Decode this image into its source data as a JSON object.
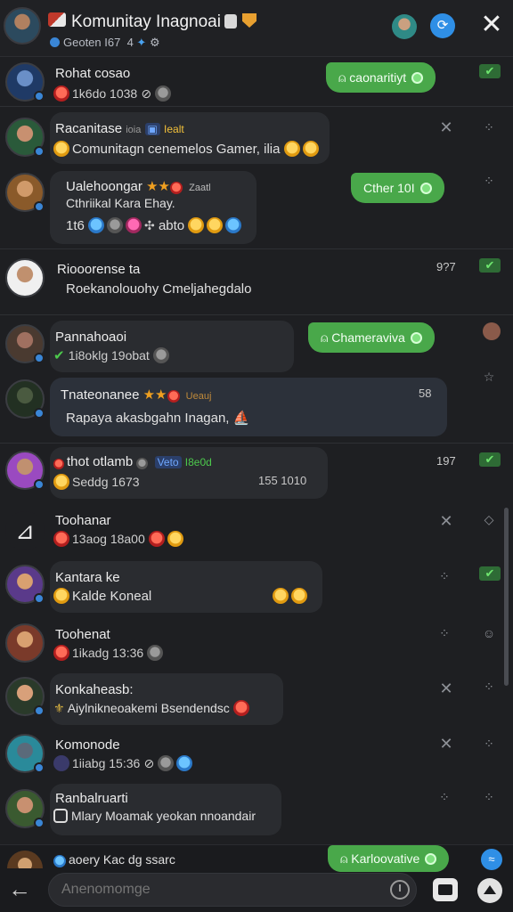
{
  "header": {
    "title": "Komunitay Inagnoai",
    "subtitle": "Geoten I67",
    "subtitle_extra": "4"
  },
  "messages": [
    {
      "name": "Rohat cosao",
      "line": "1k6do 1038",
      "chip": "caonaritiyt"
    },
    {
      "name": "Racanitase",
      "tag1": "ioia",
      "tag2": "Iealt",
      "line": "Comunitagn cenemelos Gamer, ilia"
    },
    {
      "name": "Ualehoongar",
      "tag1": "Zaatl",
      "line1": "Cthriikal Kara Ehay.",
      "line": "1t6",
      "tail": "abto",
      "chip": "Cther 10I"
    },
    {
      "name": "Riooorense ta",
      "line": "Roekanolouohy Cmeljahegdalo",
      "time": "9?7"
    },
    {
      "name": "Pannahoaoi",
      "line": "1i8oklg 19obat",
      "chip": "Chameraviva"
    },
    {
      "name": "Tnateonanee",
      "tag1": "Ueauj",
      "line": "Rapaya akasbgahn Inagan,",
      "time": "58"
    },
    {
      "name": "thot otlamb",
      "tag1": "Veto",
      "tag2": "I8e0d",
      "line": "Seddg 1673",
      "time": "155 1010",
      "time2": "197"
    },
    {
      "name": "Toohanar",
      "line": "13aog 18a00"
    },
    {
      "name": "Kantara ke",
      "line": "Kalde Koneal"
    },
    {
      "name": "Toohenat",
      "line": "1ikadg 13:36"
    },
    {
      "name": "Konkaheasb:",
      "line": "Aiylnikneoakemi Bsendendsc"
    },
    {
      "name": "Komonode",
      "line": "1iiabg 15:36"
    },
    {
      "name": "Ranbalruarti",
      "line": "Mlary Moamak yeokan nnoandair"
    }
  ],
  "footer_preview": {
    "line": "aoery Kac dg ssarc",
    "chip": "Karloovative"
  },
  "compose": {
    "placeholder": "Anenomomge"
  },
  "colors": {
    "accent_green": "#49a84a",
    "accent_blue": "#2f8fe6",
    "background": "#1e1f22",
    "bubble": "#2a2c30"
  }
}
